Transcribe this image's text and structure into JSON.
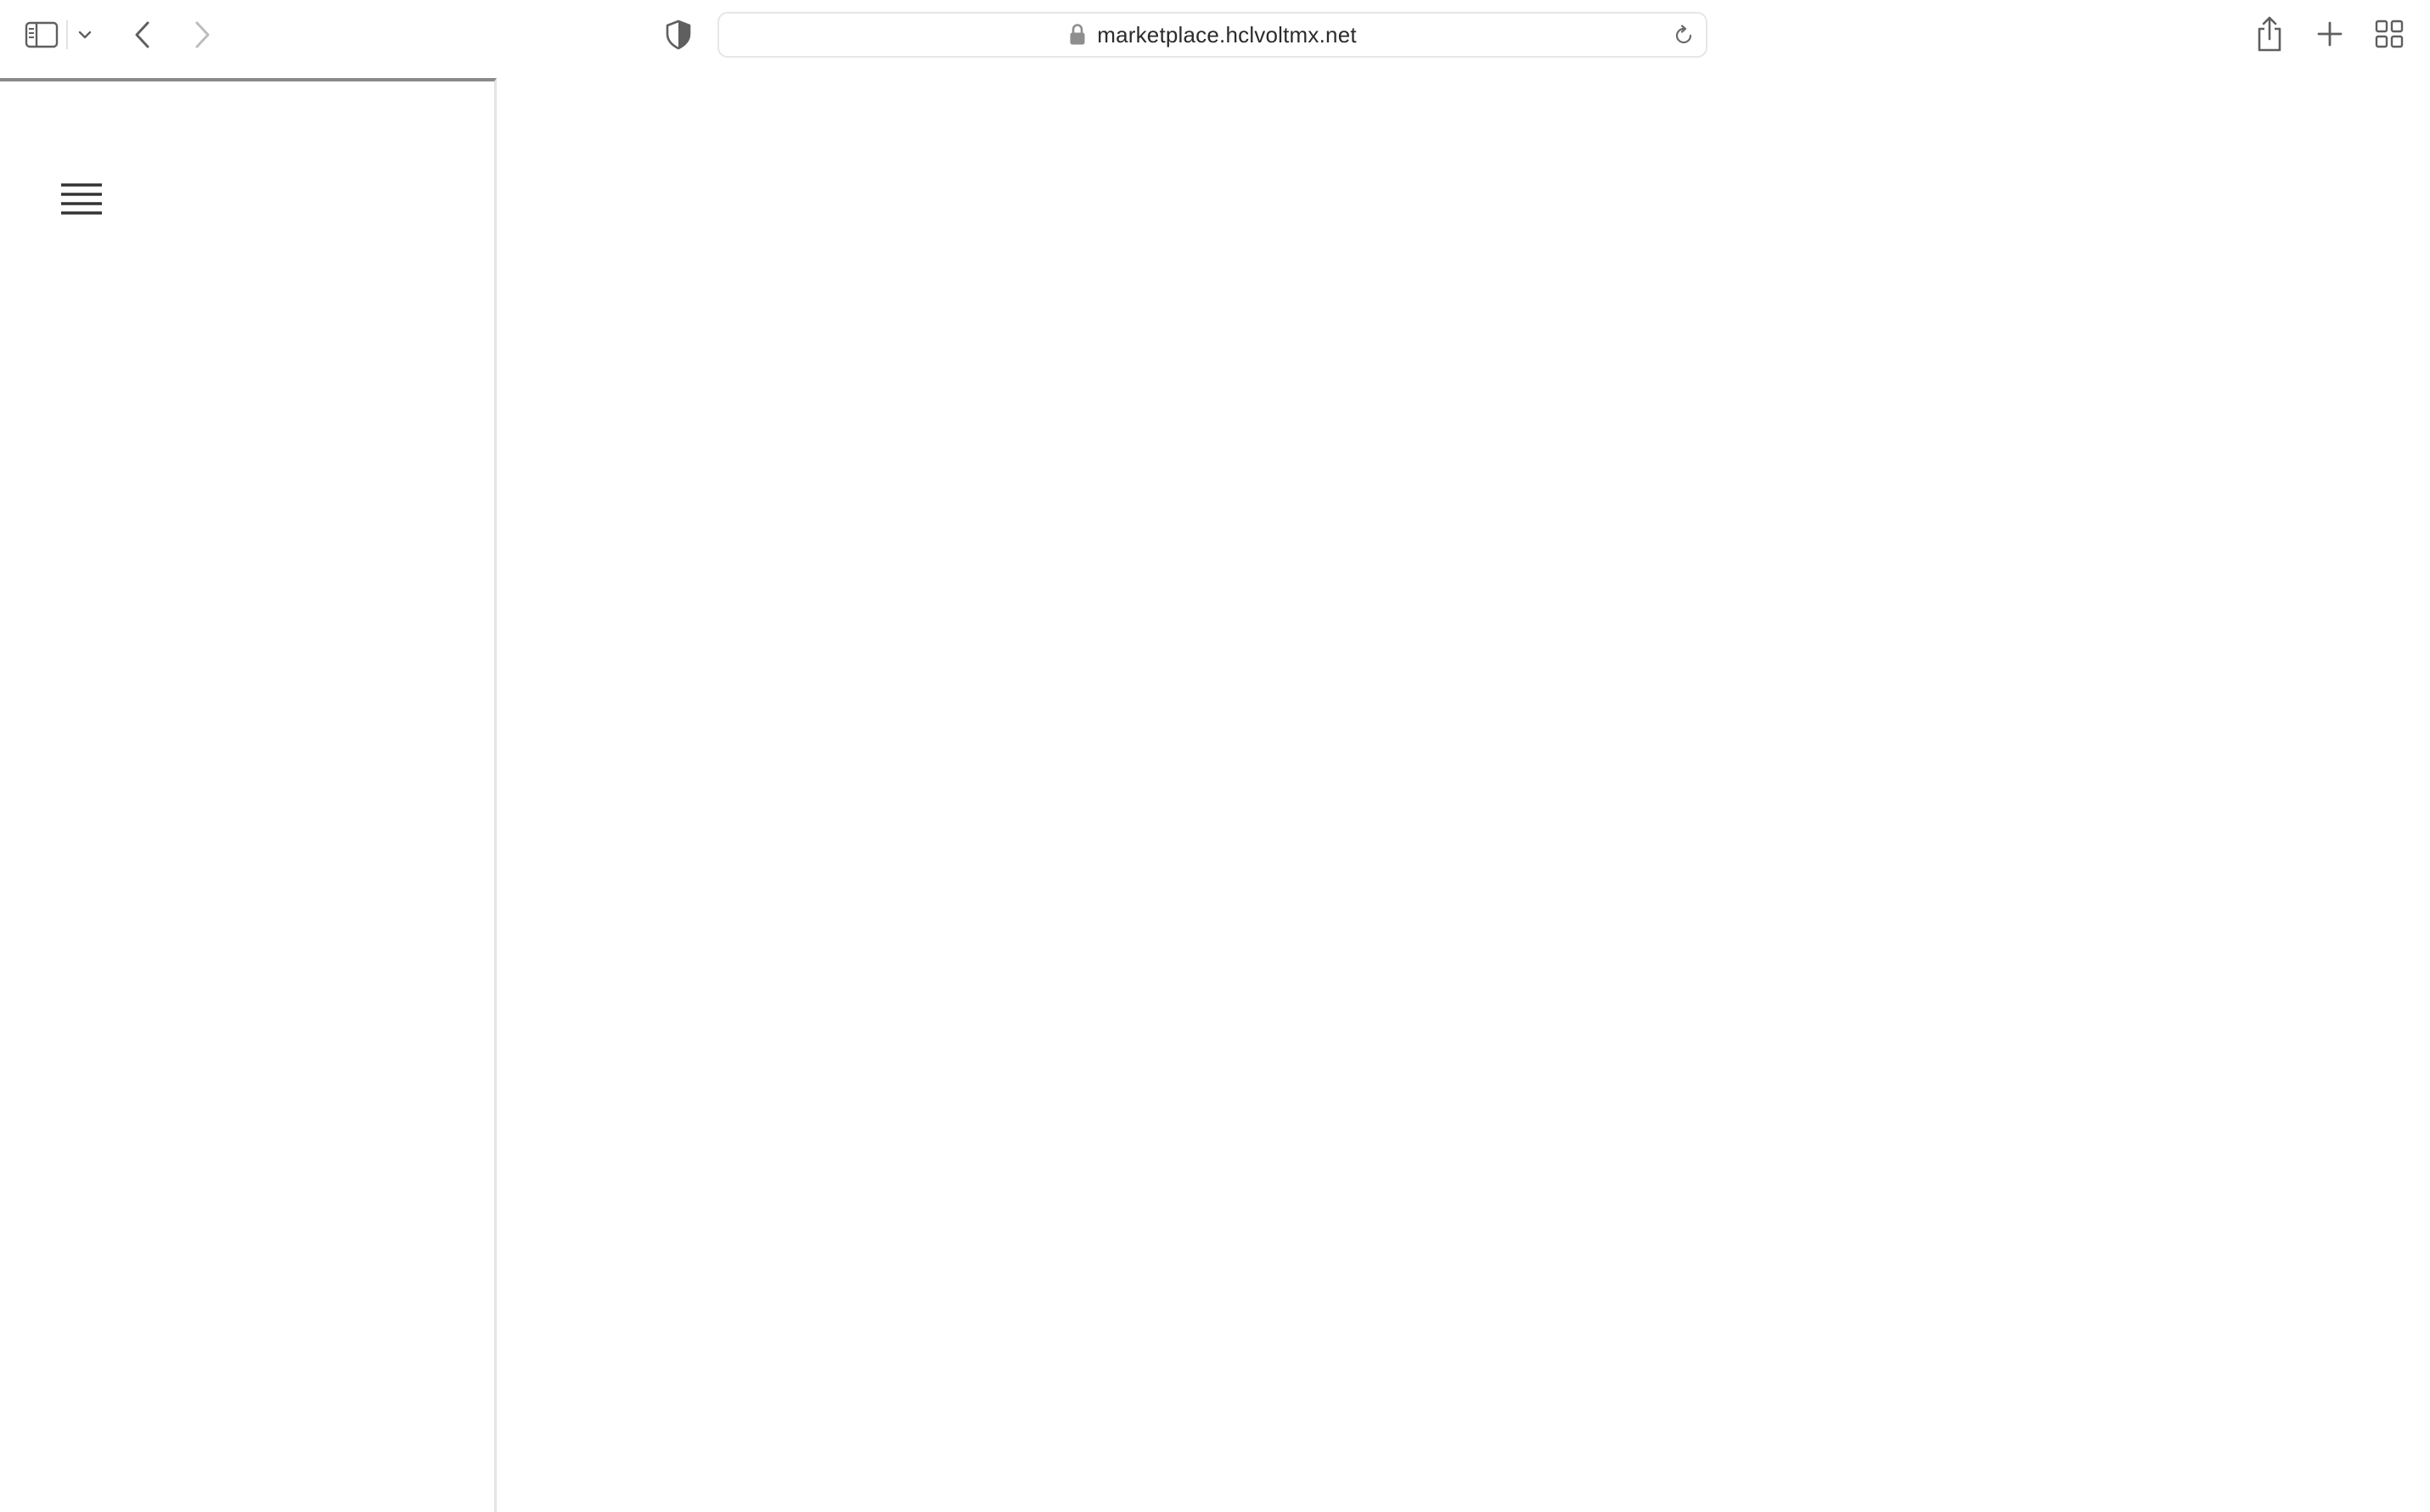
{
  "browser": {
    "url": "marketplace.hclvoltmx.net",
    "icons": {
      "sidebar_toggle": "sidebar-icon",
      "sidebar_menu": "chevron-down-icon",
      "back": "chevron-left-icon",
      "forward": "chevron-right-icon",
      "privacy": "shield-icon",
      "lock": "lock-icon",
      "reload": "reload-icon",
      "share": "share-icon",
      "new_tab": "plus-icon",
      "tab_overview": "grid-icon"
    },
    "colors": {
      "icon": "#5f5f5f",
      "icon_disabled": "#bdbdbd",
      "address_border": "#e6e6e6"
    }
  },
  "page": {
    "menu_icon": "hamburger-icon",
    "colors": {
      "panel_top_border": "#8a8a8a",
      "panel_divider": "#e4e4e4",
      "menu_icon": "#333333"
    }
  }
}
